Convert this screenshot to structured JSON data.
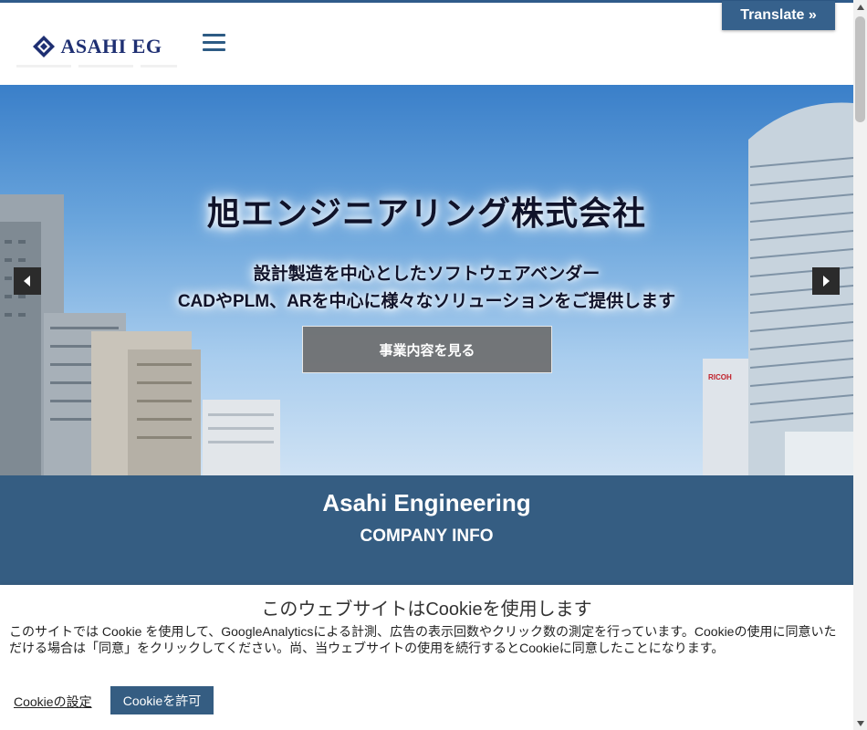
{
  "header": {
    "logo_text": "ASAHI EG",
    "menu_icon": "hamburger-menu-icon",
    "translate_label": "Translate »"
  },
  "hero": {
    "title": "旭エンジニアリング株式会社",
    "subtitle_line1": "設計製造を中心としたソフトウェアベンダー",
    "subtitle_line2": "CADやPLM、ARを中心に様々なソリューションをご提供します",
    "cta_label": "事業内容を見る",
    "prev_icon": "chevron-left-icon",
    "next_icon": "chevron-right-icon"
  },
  "band": {
    "title": "Asahi Engineering",
    "subtitle": "COMPANY INFO"
  },
  "cookie": {
    "title": "このウェブサイトはCookieを使用します",
    "body": "このサイトでは Cookie を使用して、GoogleAnalyticsによる計測、広告の表示回数やクリック数の測定を行っています。Cookieの使用に同意いただける場合は「同意」をクリックしてください。尚、当ウェブサイトの使用を続行するとCookieに同意したことになります。",
    "settings_label": "Cookieの設定",
    "accept_label": "Cookieを許可"
  },
  "colors": {
    "brand": "#355d82",
    "logo_navy": "#1e2f72",
    "accent_line": "#2f5b8a"
  }
}
